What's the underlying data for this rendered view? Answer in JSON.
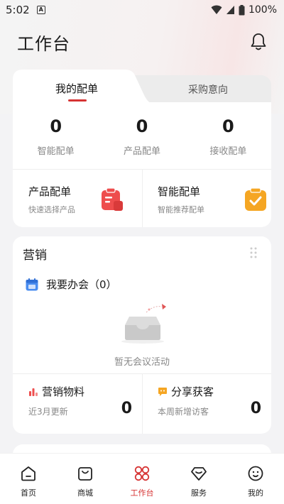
{
  "status_bar": {
    "time": "5:02",
    "battery": "100%"
  },
  "header": {
    "title": "工作台"
  },
  "match_tabs": {
    "active": "我的配单",
    "inactive": "采购意向"
  },
  "stats": [
    {
      "value": "0",
      "label": "智能配单"
    },
    {
      "value": "0",
      "label": "产品配单"
    },
    {
      "value": "0",
      "label": "接收配单"
    }
  ],
  "quick_actions": [
    {
      "title": "产品配单",
      "subtitle": "快速选择产品",
      "icon": "clipboard-red-icon",
      "color": "#ee4d4d"
    },
    {
      "title": "智能配单",
      "subtitle": "智能推荐配单",
      "icon": "clipboard-check-orange-icon",
      "color": "#f5a623"
    }
  ],
  "marketing": {
    "title": "营销",
    "meeting_label": "我要办会（0）",
    "empty_text": "暂无会议活动",
    "materials": {
      "title": "营销物料",
      "subtitle": "近3月更新",
      "value": "0"
    },
    "share": {
      "title": "分享获客",
      "subtitle": "本周新增访客",
      "value": "0"
    }
  },
  "bottom_nav": [
    {
      "label": "首页",
      "icon": "home-icon",
      "active": false
    },
    {
      "label": "商城",
      "icon": "shopping-bag-icon",
      "active": false
    },
    {
      "label": "工作台",
      "icon": "workbench-icon",
      "active": true
    },
    {
      "label": "服务",
      "icon": "diamond-icon",
      "active": false
    },
    {
      "label": "我的",
      "icon": "smiley-icon",
      "active": false
    }
  ],
  "colors": {
    "accent": "#d63333",
    "background": "#f3f3f5"
  }
}
